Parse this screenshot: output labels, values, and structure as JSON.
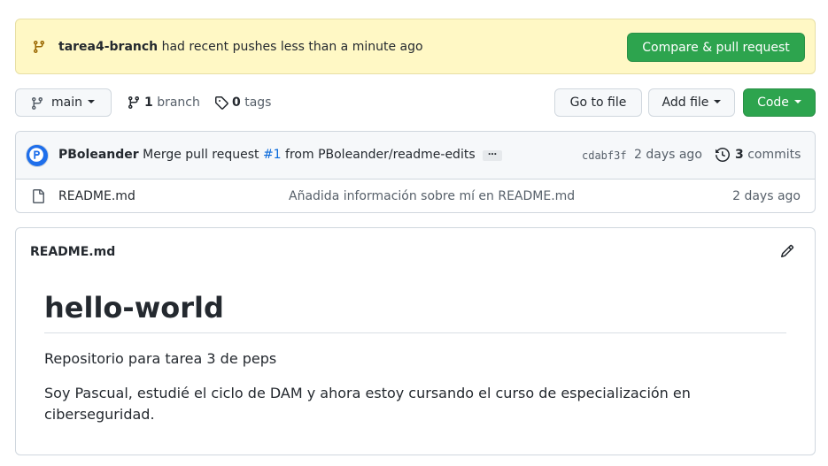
{
  "banner": {
    "branch": "tarea4-branch",
    "message": " had recent pushes less than a minute ago",
    "compare_button": "Compare & pull request"
  },
  "toolbar": {
    "branch_selector": "main",
    "branch_count": "1",
    "branch_label": " branch",
    "tag_count": "0",
    "tag_label": " tags",
    "goto_file": "Go to file",
    "add_file": "Add file",
    "code": "Code"
  },
  "latest_commit": {
    "author": "PBoleander",
    "message_prefix": " Merge pull request ",
    "pr_link": "#1",
    "message_suffix": " from PBoleander/readme-edits",
    "ellipsis": "…",
    "sha": "cdabf3f",
    "age": "2 days ago",
    "commit_count": "3",
    "commits_label": " commits"
  },
  "files": [
    {
      "name": "README.md",
      "commit_message": "Añadida información sobre mí en README.md",
      "age": "2 days ago"
    }
  ],
  "readme": {
    "filename": "README.md",
    "heading": "hello-world",
    "paragraphs": [
      "Repositorio para tarea 3 de peps",
      "Soy Pascual, estudié el ciclo de DAM y ahora estoy cursando el curso de especialización en ciberseguridad."
    ]
  },
  "colors": {
    "banner_bg": "#fff8c5",
    "primary_green": "#2da44e",
    "link_blue": "#0969da",
    "muted_text": "#57606a"
  }
}
